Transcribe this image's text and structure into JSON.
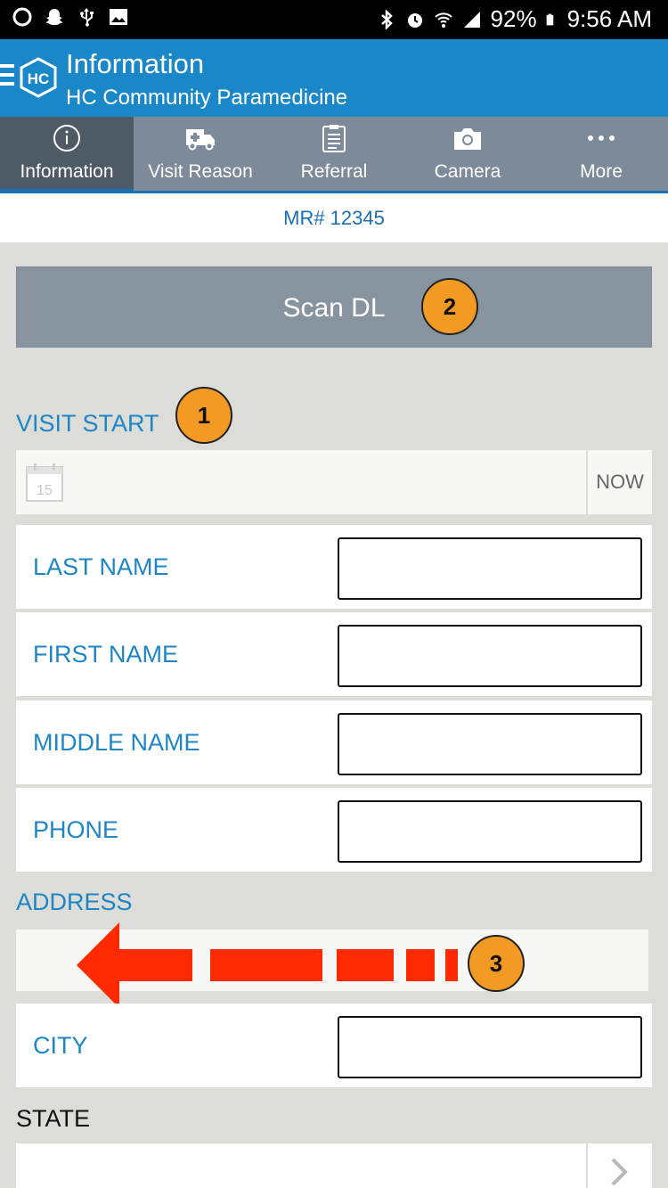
{
  "status_bar": {
    "battery": "92%",
    "time": "9:56 AM",
    "icons": [
      "circle-icon",
      "snapchat-icon",
      "usb-icon",
      "image-icon",
      "bluetooth-icon",
      "alarm-icon",
      "wifi-icon",
      "signal-icon",
      "battery-icon"
    ]
  },
  "app_bar": {
    "title": "Information",
    "subtitle": "HC Community Paramedicine",
    "logo_text": "HC",
    "color": "#1a88c8"
  },
  "tabs": [
    {
      "label": "Information",
      "icon": "info-icon",
      "active": true
    },
    {
      "label": "Visit Reason",
      "icon": "ambulance-icon",
      "active": false
    },
    {
      "label": "Referral",
      "icon": "clipboard-icon",
      "active": false
    },
    {
      "label": "Camera",
      "icon": "camera-icon",
      "active": false
    },
    {
      "label": "More",
      "icon": "more-icon",
      "active": false
    }
  ],
  "record": {
    "mr_number": "MR# 12345"
  },
  "scan_button": {
    "label": "Scan DL"
  },
  "visit_start": {
    "label": "VISIT START",
    "calendar_day": "15",
    "now_label": "NOW"
  },
  "fields": [
    {
      "label": "LAST NAME",
      "value": ""
    },
    {
      "label": "FIRST NAME",
      "value": ""
    },
    {
      "label": "MIDDLE NAME",
      "value": ""
    },
    {
      "label": "PHONE",
      "value": ""
    }
  ],
  "address": {
    "label": "ADDRESS",
    "value": ""
  },
  "city": {
    "label": "CITY",
    "value": ""
  },
  "state": {
    "label": "STATE",
    "value": ""
  },
  "annotations": {
    "badge_1": "1",
    "badge_2": "2",
    "badge_3": "3"
  },
  "colors": {
    "accent": "#1f86c6",
    "badge": "#f39a25",
    "arrow": "#ff2a00",
    "tab_bar": "#7c8a99"
  }
}
